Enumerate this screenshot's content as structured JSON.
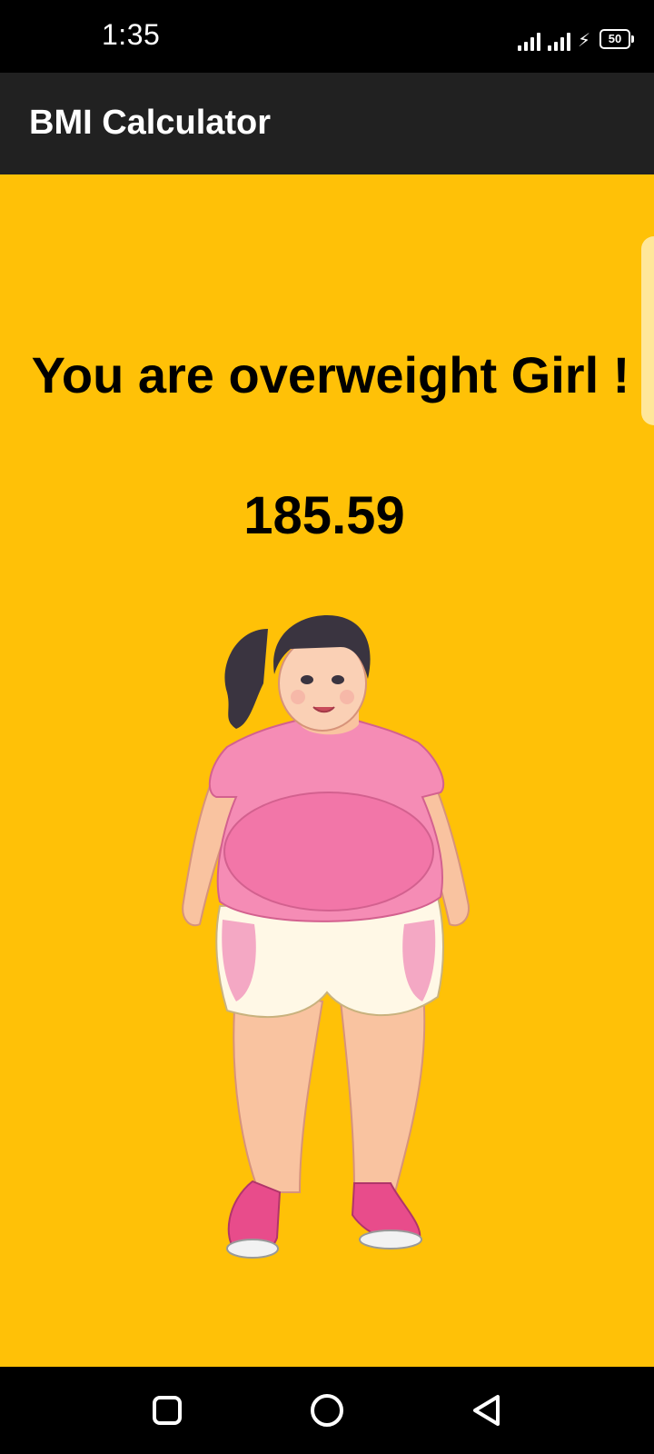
{
  "status_bar": {
    "time": "1:35",
    "battery_level": "50",
    "icons": [
      "signal-icon",
      "signal-icon",
      "charging-icon",
      "battery-icon"
    ]
  },
  "app_bar": {
    "title": "BMI Calculator"
  },
  "result": {
    "message": "You are overweight Girl !",
    "bmi_value": "185.59",
    "illustration": "overweight-girl-illustration"
  },
  "nav_bar": {
    "icons": [
      "recent-apps-icon",
      "home-icon",
      "back-icon"
    ]
  },
  "colors": {
    "background": "#FFC107",
    "app_bar": "#212121",
    "status_bar": "#000000",
    "text": "#000000"
  }
}
